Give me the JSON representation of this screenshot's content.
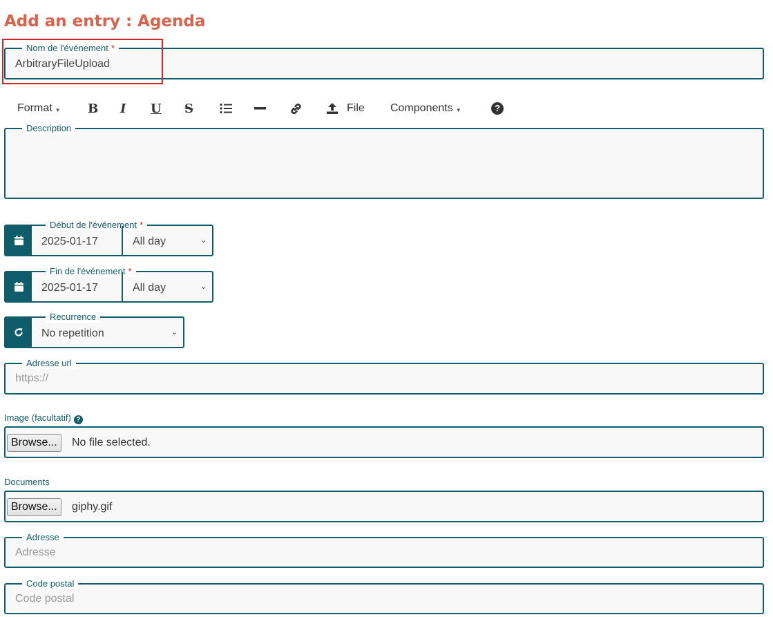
{
  "page": {
    "title": "Add an entry :  Agenda"
  },
  "event_name": {
    "label": "Nom de l'événement",
    "required_mark": "*",
    "value": "ArbitraryFileUpload"
  },
  "toolbar": {
    "format": "Format",
    "file": "File",
    "components": "Components",
    "icons": [
      "bold-icon",
      "italic-icon",
      "underline-icon",
      "strikethrough-icon",
      "list-icon",
      "horizontal-rule-icon",
      "link-icon",
      "upload-icon",
      "help-icon"
    ]
  },
  "description": {
    "label": "Description"
  },
  "start": {
    "label": "Début de l'événement",
    "required_mark": "*",
    "date": "2025-01-17",
    "time": "All day"
  },
  "end": {
    "label": "Fin de l'événement",
    "required_mark": "*",
    "date": "2025-01-17",
    "time": "All day"
  },
  "recurrence": {
    "label": "Recurrence",
    "value": "No repetition"
  },
  "url": {
    "label": "Adresse url",
    "placeholder": "https://"
  },
  "image": {
    "label": "Image (facultatif)",
    "button": "Browse...",
    "status": "No file selected."
  },
  "documents": {
    "label": "Documents",
    "button": "Browse...",
    "file": "giphy.gif"
  },
  "address": {
    "label": "Adresse",
    "placeholder": "Adresse"
  },
  "postal_code": {
    "label": "Code postal",
    "placeholder": "Code postal"
  },
  "colors": {
    "accent": "#0f5c6b",
    "title": "#d9624b",
    "highlight": "#e02020"
  }
}
